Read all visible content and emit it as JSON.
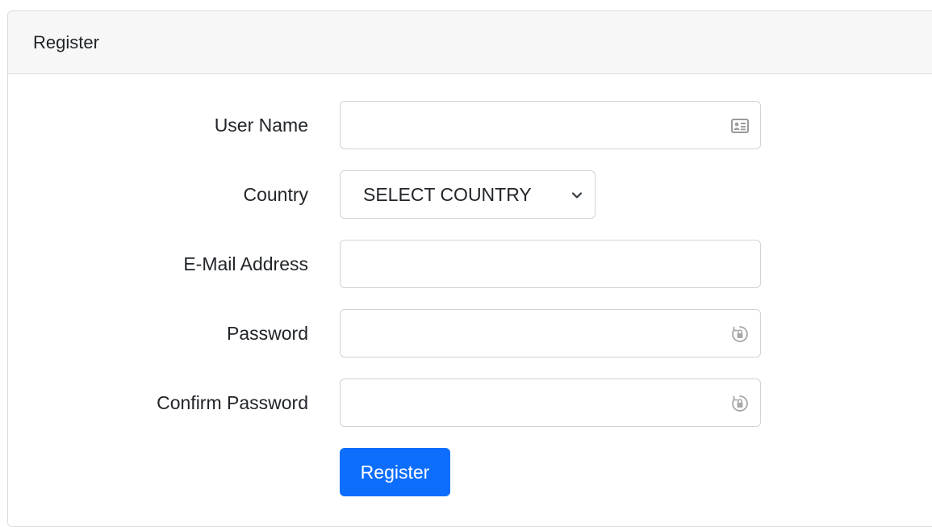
{
  "card": {
    "title": "Register"
  },
  "form": {
    "username": {
      "label": "User Name",
      "value": "",
      "icon": "contact-card-icon"
    },
    "country": {
      "label": "Country",
      "selected": "SELECT COUNTRY",
      "icon": "chevron-down-icon"
    },
    "email": {
      "label": "E-Mail Address",
      "value": ""
    },
    "password": {
      "label": "Password",
      "value": "",
      "icon": "password-manager-icon"
    },
    "confirm_password": {
      "label": "Confirm Password",
      "value": "",
      "icon": "password-manager-icon"
    },
    "submit_label": "Register"
  },
  "colors": {
    "primary": "#0d6efd",
    "header_bg": "#f7f7f7",
    "border": "#ced4da",
    "icon": "#a8a8a8"
  }
}
